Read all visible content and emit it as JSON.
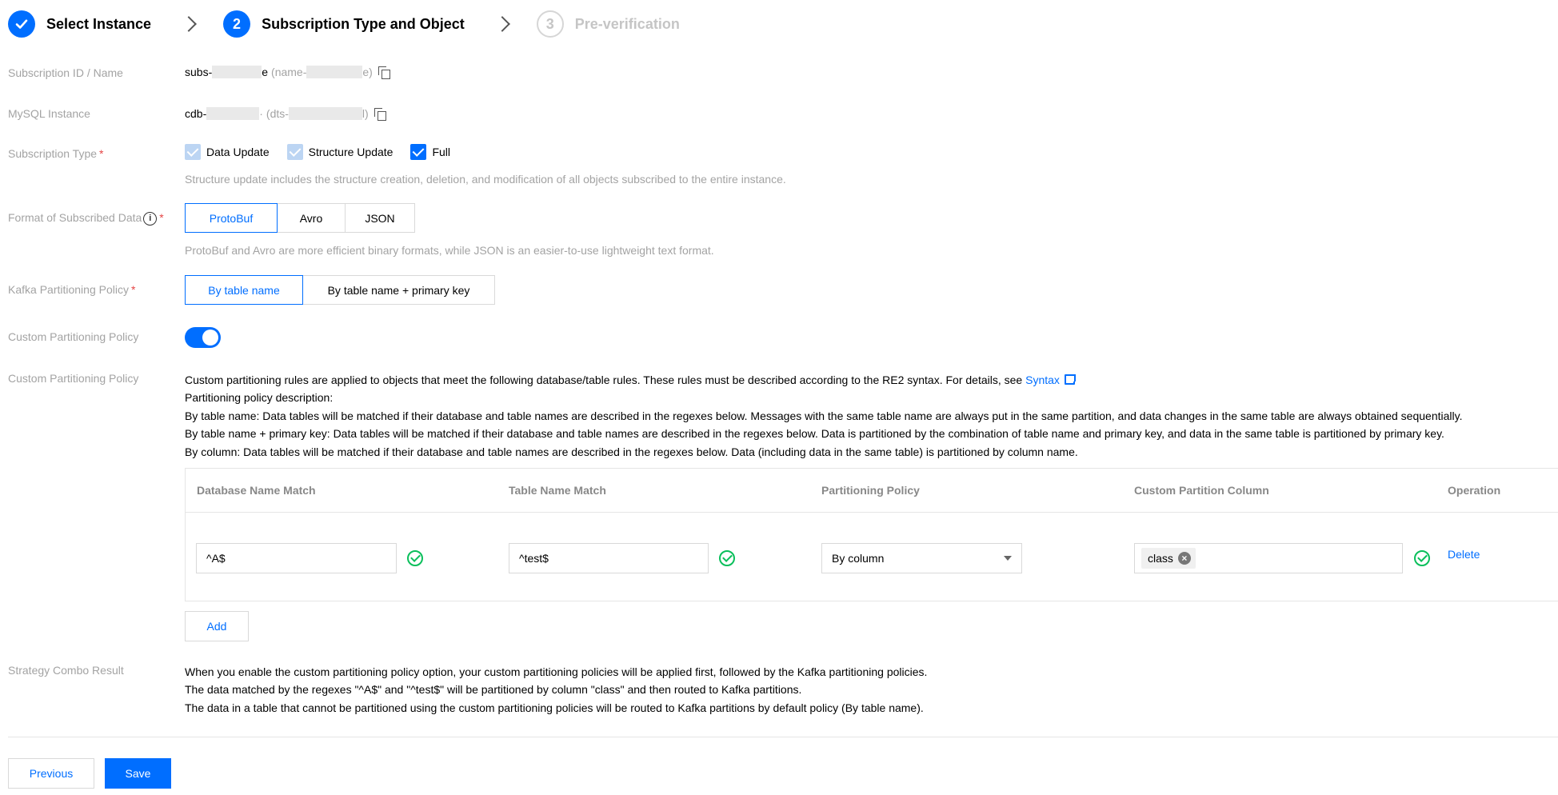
{
  "steps": [
    {
      "number": "",
      "title": "Select Instance",
      "state": "done"
    },
    {
      "number": "2",
      "title": "Subscription Type and Object",
      "state": "active"
    },
    {
      "number": "3",
      "title": "Pre-verification",
      "state": "pending"
    }
  ],
  "subscription": {
    "label": "Subscription ID / Name",
    "id_prefix": "subs-",
    "id_suffix": "e",
    "name_prefix": "(name-",
    "name_suffix": "e)"
  },
  "mysql": {
    "label": "MySQL Instance",
    "id_prefix": "cdb-",
    "id_suffix": "·",
    "dts_prefix": "(dts-",
    "dts_suffix": "l)"
  },
  "subscription_type": {
    "label": "Subscription Type",
    "required": "*",
    "options": [
      "Data Update",
      "Structure Update",
      "Full"
    ],
    "hint": "Structure update includes the structure creation, deletion, and modification of all objects subscribed to the entire instance."
  },
  "format": {
    "label": "Format of Subscribed Data",
    "info": "i",
    "required": "*",
    "options": [
      "ProtoBuf",
      "Avro",
      "JSON"
    ],
    "selected": "ProtoBuf",
    "hint": "ProtoBuf and Avro are more efficient binary formats, while JSON is an easier-to-use lightweight text format."
  },
  "kafka": {
    "label": "Kafka Partitioning Policy",
    "required": "*",
    "options": [
      "By table name",
      "By table name + primary key"
    ],
    "selected": "By table name"
  },
  "custom_toggle": {
    "label": "Custom Partitioning Policy",
    "on": true
  },
  "custom_policy": {
    "label": "Custom Partitioning Policy",
    "intro": "Custom partitioning rules are applied to objects that meet the following database/table rules. These rules must be described according to the RE2 syntax. For details, see",
    "syntax_link": "Syntax",
    "desc_title": "Partitioning policy description:",
    "desc_table": "By table name: Data tables will be matched if their database and table names are described in the regexes below. Messages with the same table name are always put in the same partition, and data changes in the same table are always obtained sequentially.",
    "desc_pk": "By table name + primary key: Data tables will be matched if their database and table names are described in the regexes below. Data is partitioned by the combination of table name and primary key, and data in the same table is partitioned by primary key.",
    "desc_column": "By column: Data tables will be matched if their database and table names are described in the regexes below. Data (including data in the same table) is partitioned by column name."
  },
  "table": {
    "headers": [
      "Database Name Match",
      "Table Name Match",
      "Partitioning Policy",
      "Custom Partition Column",
      "Operation"
    ],
    "rows": [
      {
        "db": "^A$",
        "table": "^test$",
        "policy": "By column",
        "column_tag": "class",
        "tag_remove": "×",
        "action": "Delete"
      }
    ]
  },
  "add_label": "Add",
  "combo": {
    "label": "Strategy Combo Result",
    "line1": "When you enable the custom partitioning policy option, your custom partitioning policies will be applied first, followed by the Kafka partitioning policies.",
    "line2": "The data matched by the regexes \"^A$\" and \"^test$\" will be partitioned by column \"class\" and then routed to Kafka partitions.",
    "line3": "The data in a table that cannot be partitioned using the custom partitioning policies will be routed to Kafka partitions by default policy (By table name)."
  },
  "footer": {
    "previous": "Previous",
    "save": "Save"
  },
  "colors": {
    "primary": "#006eff",
    "success": "#0abf5b",
    "required": "#e54545",
    "muted": "#a3a3a3"
  }
}
